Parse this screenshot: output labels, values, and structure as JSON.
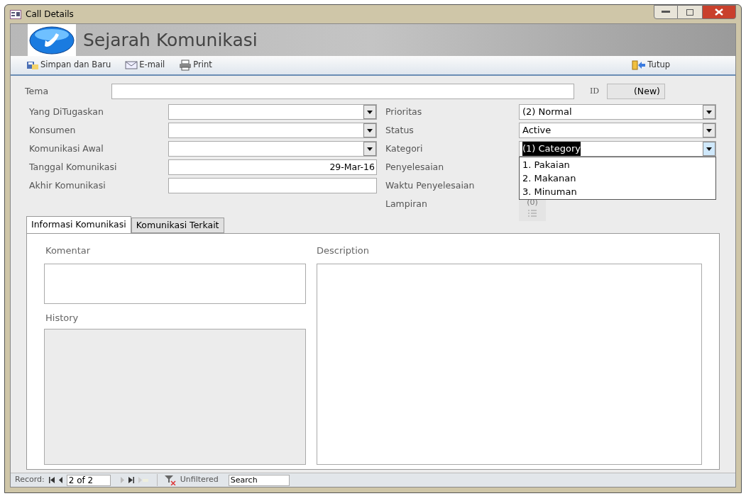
{
  "window": {
    "title": "Call Details"
  },
  "header": {
    "title": "Sejarah Komunikasi"
  },
  "toolbar": {
    "left": [
      {
        "label": "Simpan dan Baru",
        "kind": "save"
      },
      {
        "label": "E-mail",
        "kind": "mail"
      },
      {
        "label": "Print",
        "kind": "print"
      }
    ],
    "right": {
      "label": "Tutup",
      "kind": "close"
    }
  },
  "tema": {
    "label": "Tema"
  },
  "id": {
    "label": "ID",
    "value": "(New)"
  },
  "left_fields": [
    {
      "label": "Yang DiTugaskan",
      "kind": "combo"
    },
    {
      "label": "Konsumen",
      "kind": "combo"
    },
    {
      "label": "Komunikasi Awal",
      "kind": "combo"
    },
    {
      "label": "Tanggal Komunikasi",
      "kind": "date",
      "value": "29-Mar-16"
    },
    {
      "label": "Akhir Komunikasi",
      "kind": "text"
    }
  ],
  "right_fields": [
    {
      "label": "Prioritas",
      "kind": "combo",
      "value": "(2) Normal",
      "open": false
    },
    {
      "label": "Status",
      "kind": "combo",
      "value": "Active",
      "open": false
    },
    {
      "label": "Kategori",
      "kind": "combo",
      "value": "(1) Category",
      "open": true,
      "options": [
        "1. Pakaian",
        "2. Makanan",
        "3. Minuman"
      ]
    },
    {
      "label": "Penyelesaian",
      "kind": "hidden"
    },
    {
      "label": "Waktu Penyelesaian",
      "kind": "hidden"
    },
    {
      "label": "Lampiran",
      "kind": "attachment",
      "count": "(0)"
    }
  ],
  "tabs": [
    {
      "label": "Informasi Komunikasi",
      "selected": true
    },
    {
      "label": "Komunikasi Terkait",
      "selected": false
    }
  ],
  "panel": {
    "komentar": "Komentar",
    "history": "History",
    "description": "Description"
  },
  "status_bar": {
    "record_label": "Record:",
    "position": "2 of 2",
    "filter": "Unfiltered",
    "search": "Search"
  }
}
